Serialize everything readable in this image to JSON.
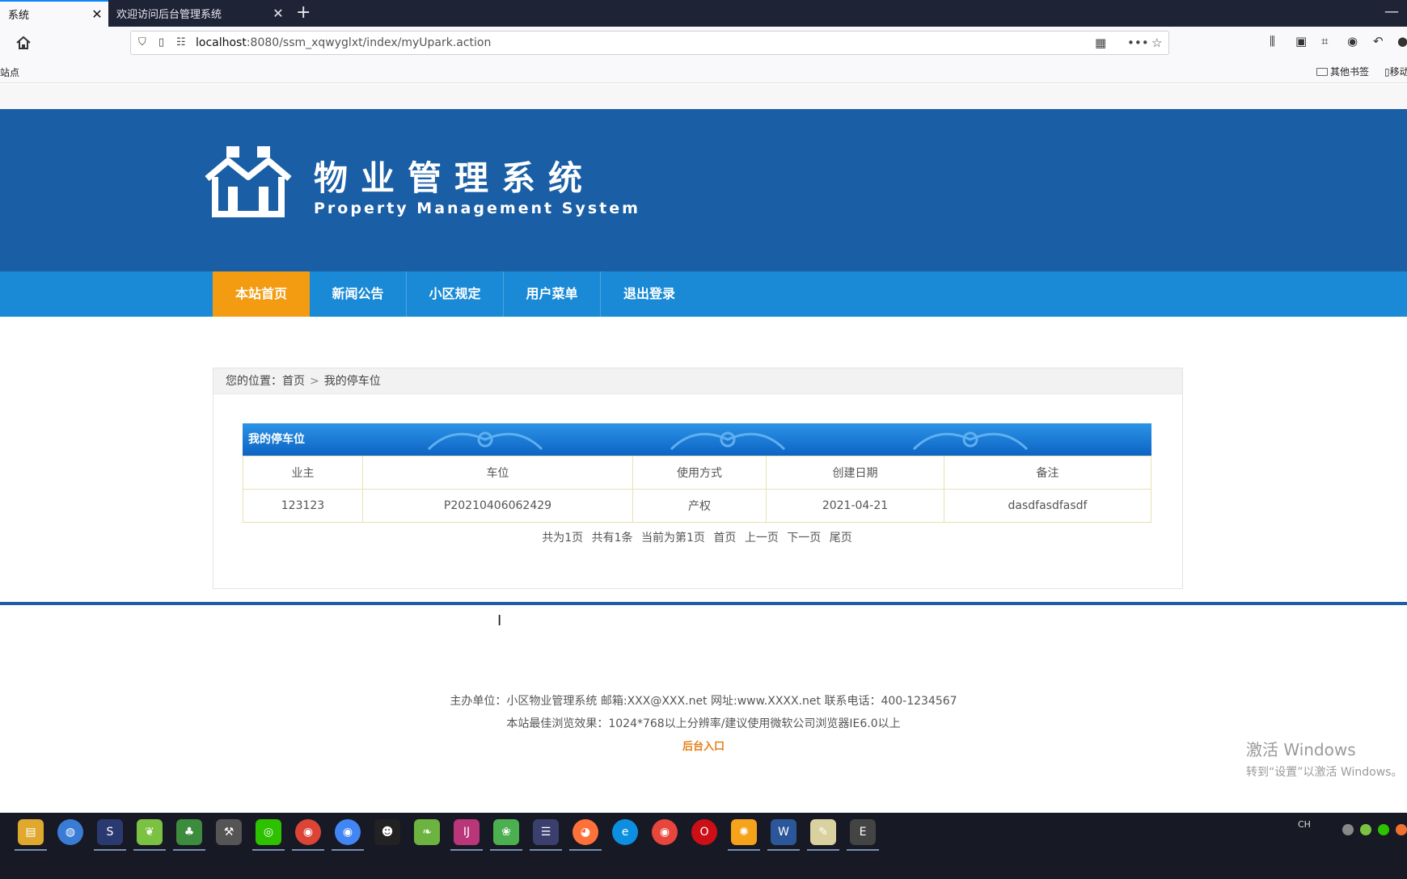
{
  "browser": {
    "tabs": [
      {
        "title": "系统",
        "active": true
      },
      {
        "title": "欢迎访问后台管理系统",
        "active": false
      }
    ],
    "new_tab": "+",
    "url_host": "localhost",
    "url_path": ":8080/ssm_xqwyglxt/index/myUpark.action",
    "bookmarks_left": "站点",
    "bookmarks_other": "其他书签",
    "bookmarks_mobile": "移动"
  },
  "site": {
    "logo_cn": "物业管理系统",
    "logo_en": "Property Management System",
    "nav": [
      {
        "label": "本站首页",
        "active": true
      },
      {
        "label": "新闻公告",
        "active": false
      },
      {
        "label": "小区规定",
        "active": false
      },
      {
        "label": "用户菜单",
        "active": false
      },
      {
        "label": "退出登录",
        "active": false
      }
    ],
    "breadcrumb": {
      "prefix": "您的位置：",
      "home": "首页",
      "separator": ">",
      "current": "我的停车位"
    },
    "panel_title": "我的停车位",
    "table": {
      "headers": [
        "业主",
        "车位",
        "使用方式",
        "创建日期",
        "备注"
      ],
      "rows": [
        [
          "123123",
          "P20210406062429",
          "产权",
          "2021-04-21",
          "dasdfasdfasdf"
        ]
      ]
    },
    "pager": {
      "total_pages": "共为1页",
      "total_items": "共有1条",
      "current": "当前为第1页",
      "first": "首页",
      "prev": "上一页",
      "next": "下一页",
      "last": "尾页"
    },
    "footer": {
      "line1": "主办单位：小区物业管理系统  邮箱:XXX@XXX.net  网址:www.XXXX.net   联系电话：400-1234567",
      "line2": "本站最佳浏览效果：1024*768以上分辨率/建议使用微软公司浏览器IE6.0以上",
      "admin_link": "后台入口"
    }
  },
  "watermark": {
    "line1": "激活 Windows",
    "line2": "转到“设置”以激活 Windows。"
  },
  "taskbar": {
    "tray_lang": "CH"
  },
  "colors": {
    "header_blue": "#1a5ea5",
    "menu_blue": "#1a8ad6",
    "menu_active": "#f39c12",
    "admin_link": "#e47e16"
  }
}
